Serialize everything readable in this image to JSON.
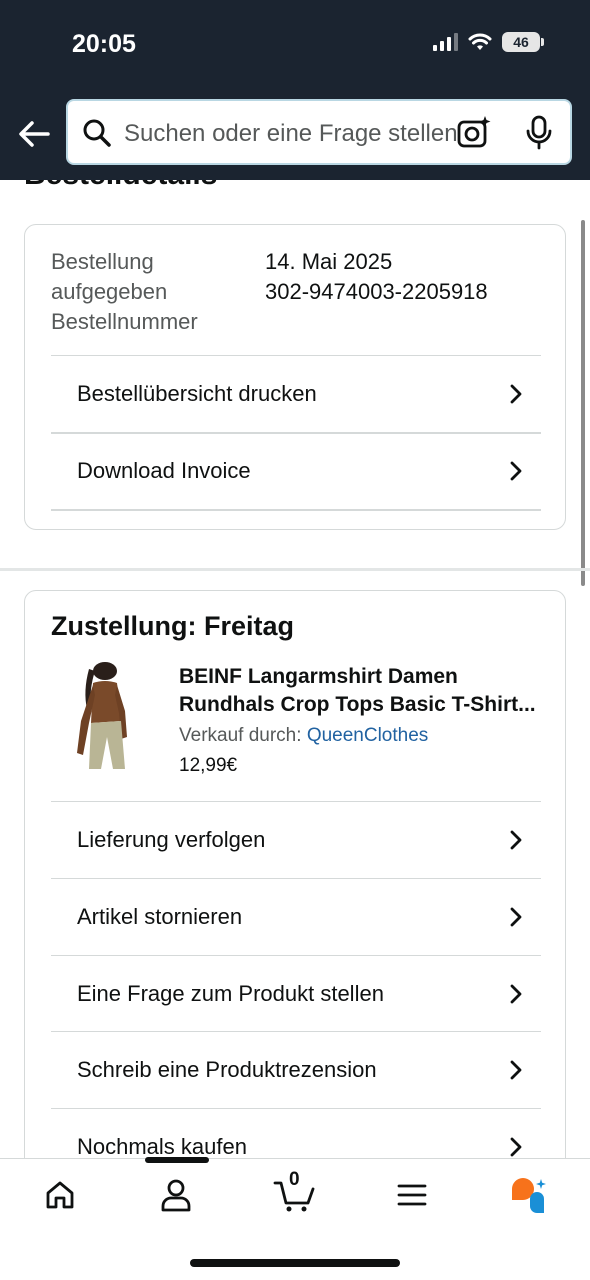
{
  "status_bar": {
    "time": "20:05",
    "battery": "46"
  },
  "search": {
    "placeholder": "Suchen oder eine Frage stellen"
  },
  "page": {
    "title": "Bestelldetails"
  },
  "order": {
    "labels": [
      "Bestellung",
      "aufgegeben",
      "Bestellnummer"
    ],
    "date": "14. Mai 2025",
    "number": "302-9474003-2205918",
    "actions": [
      "Bestellübersicht drucken",
      "Download Invoice"
    ]
  },
  "delivery": {
    "title": "Zustellung: Freitag",
    "product": {
      "title_line1": "BEINF Langarmshirt Damen",
      "title_line2": "Rundhals Crop Tops Basic T-Shirt...",
      "seller_prefix": "Verkauf durch:",
      "seller": "QueenClothes",
      "price": "12,99€"
    },
    "actions": [
      "Lieferung verfolgen",
      "Artikel stornieren",
      "Eine Frage zum Produkt stellen",
      "Schreib eine Produktrezension",
      "Nochmals kaufen"
    ]
  },
  "bottom_nav": {
    "items": [
      "home-icon",
      "account-icon",
      "cart-icon",
      "menu-icon",
      "rufus-icon"
    ],
    "cart_count": "0"
  },
  "colors": {
    "header": "#1b2430",
    "link": "#2162a1",
    "border": "#d5d9d9",
    "rufus_orange": "#f7721b",
    "rufus_blue": "#1a8fd6"
  }
}
